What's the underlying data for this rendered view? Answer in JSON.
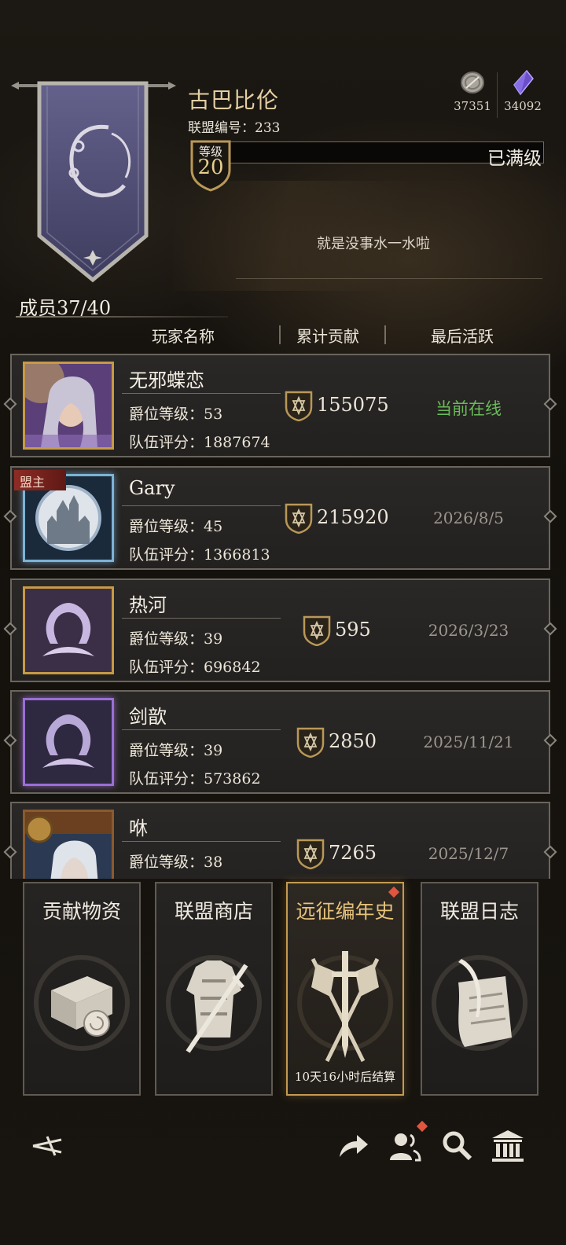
{
  "guild": {
    "name": "古巴比伦",
    "id_label": "联盟编号：233",
    "level_label": "等级",
    "level": "20",
    "level_status": "已满级",
    "motto": "就是没事水一水啦",
    "members": "成员37/40"
  },
  "currency": [
    {
      "icon": "silver-coin-icon",
      "value": "37351"
    },
    {
      "icon": "purple-crystal-icon",
      "value": "34092"
    }
  ],
  "columns": {
    "name": "玩家名称",
    "contribution": "累计贡献",
    "last_active": "最后活跃"
  },
  "players": [
    {
      "name": "无邪蝶恋",
      "rank": "爵位等级：53",
      "score": "队伍评分：1887674",
      "contribution": "155075",
      "last_active": "当前在线",
      "online": true,
      "leader": false
    },
    {
      "name": "Gary",
      "rank": "爵位等级：45",
      "score": "队伍评分：1366813",
      "contribution": "215920",
      "last_active": "2026/8/5",
      "online": false,
      "leader": true
    },
    {
      "name": "热河",
      "rank": "爵位等级：39",
      "score": "队伍评分：696842",
      "contribution": "595",
      "last_active": "2026/3/23",
      "online": false,
      "leader": false
    },
    {
      "name": "剑歆",
      "rank": "爵位等级：39",
      "score": "队伍评分：573862",
      "contribution": "2850",
      "last_active": "2025/11/21",
      "online": false,
      "leader": false
    },
    {
      "name": "咻",
      "rank": "爵位等级：38",
      "score": "",
      "contribution": "7265",
      "last_active": "2025/12/7",
      "online": false,
      "leader": false
    }
  ],
  "leader_tag": "盟主",
  "cards": [
    {
      "title": "贡献物资",
      "icon": "supplies-scroll-icon"
    },
    {
      "title": "联盟商店",
      "icon": "armor-shop-icon"
    },
    {
      "title": "远征编年史",
      "icon": "crossed-swords-banners-icon",
      "subtitle": "10天16小时后结算",
      "badge": true
    },
    {
      "title": "联盟日志",
      "icon": "quill-scroll-icon"
    }
  ],
  "nav": [
    "back-icon",
    "share-icon",
    "members-icon",
    "search-icon",
    "hall-icon"
  ],
  "colors": {
    "gold": "#c79a45",
    "online": "#6ab95a",
    "badge": "#e0553f",
    "banner": "#5a5880"
  }
}
